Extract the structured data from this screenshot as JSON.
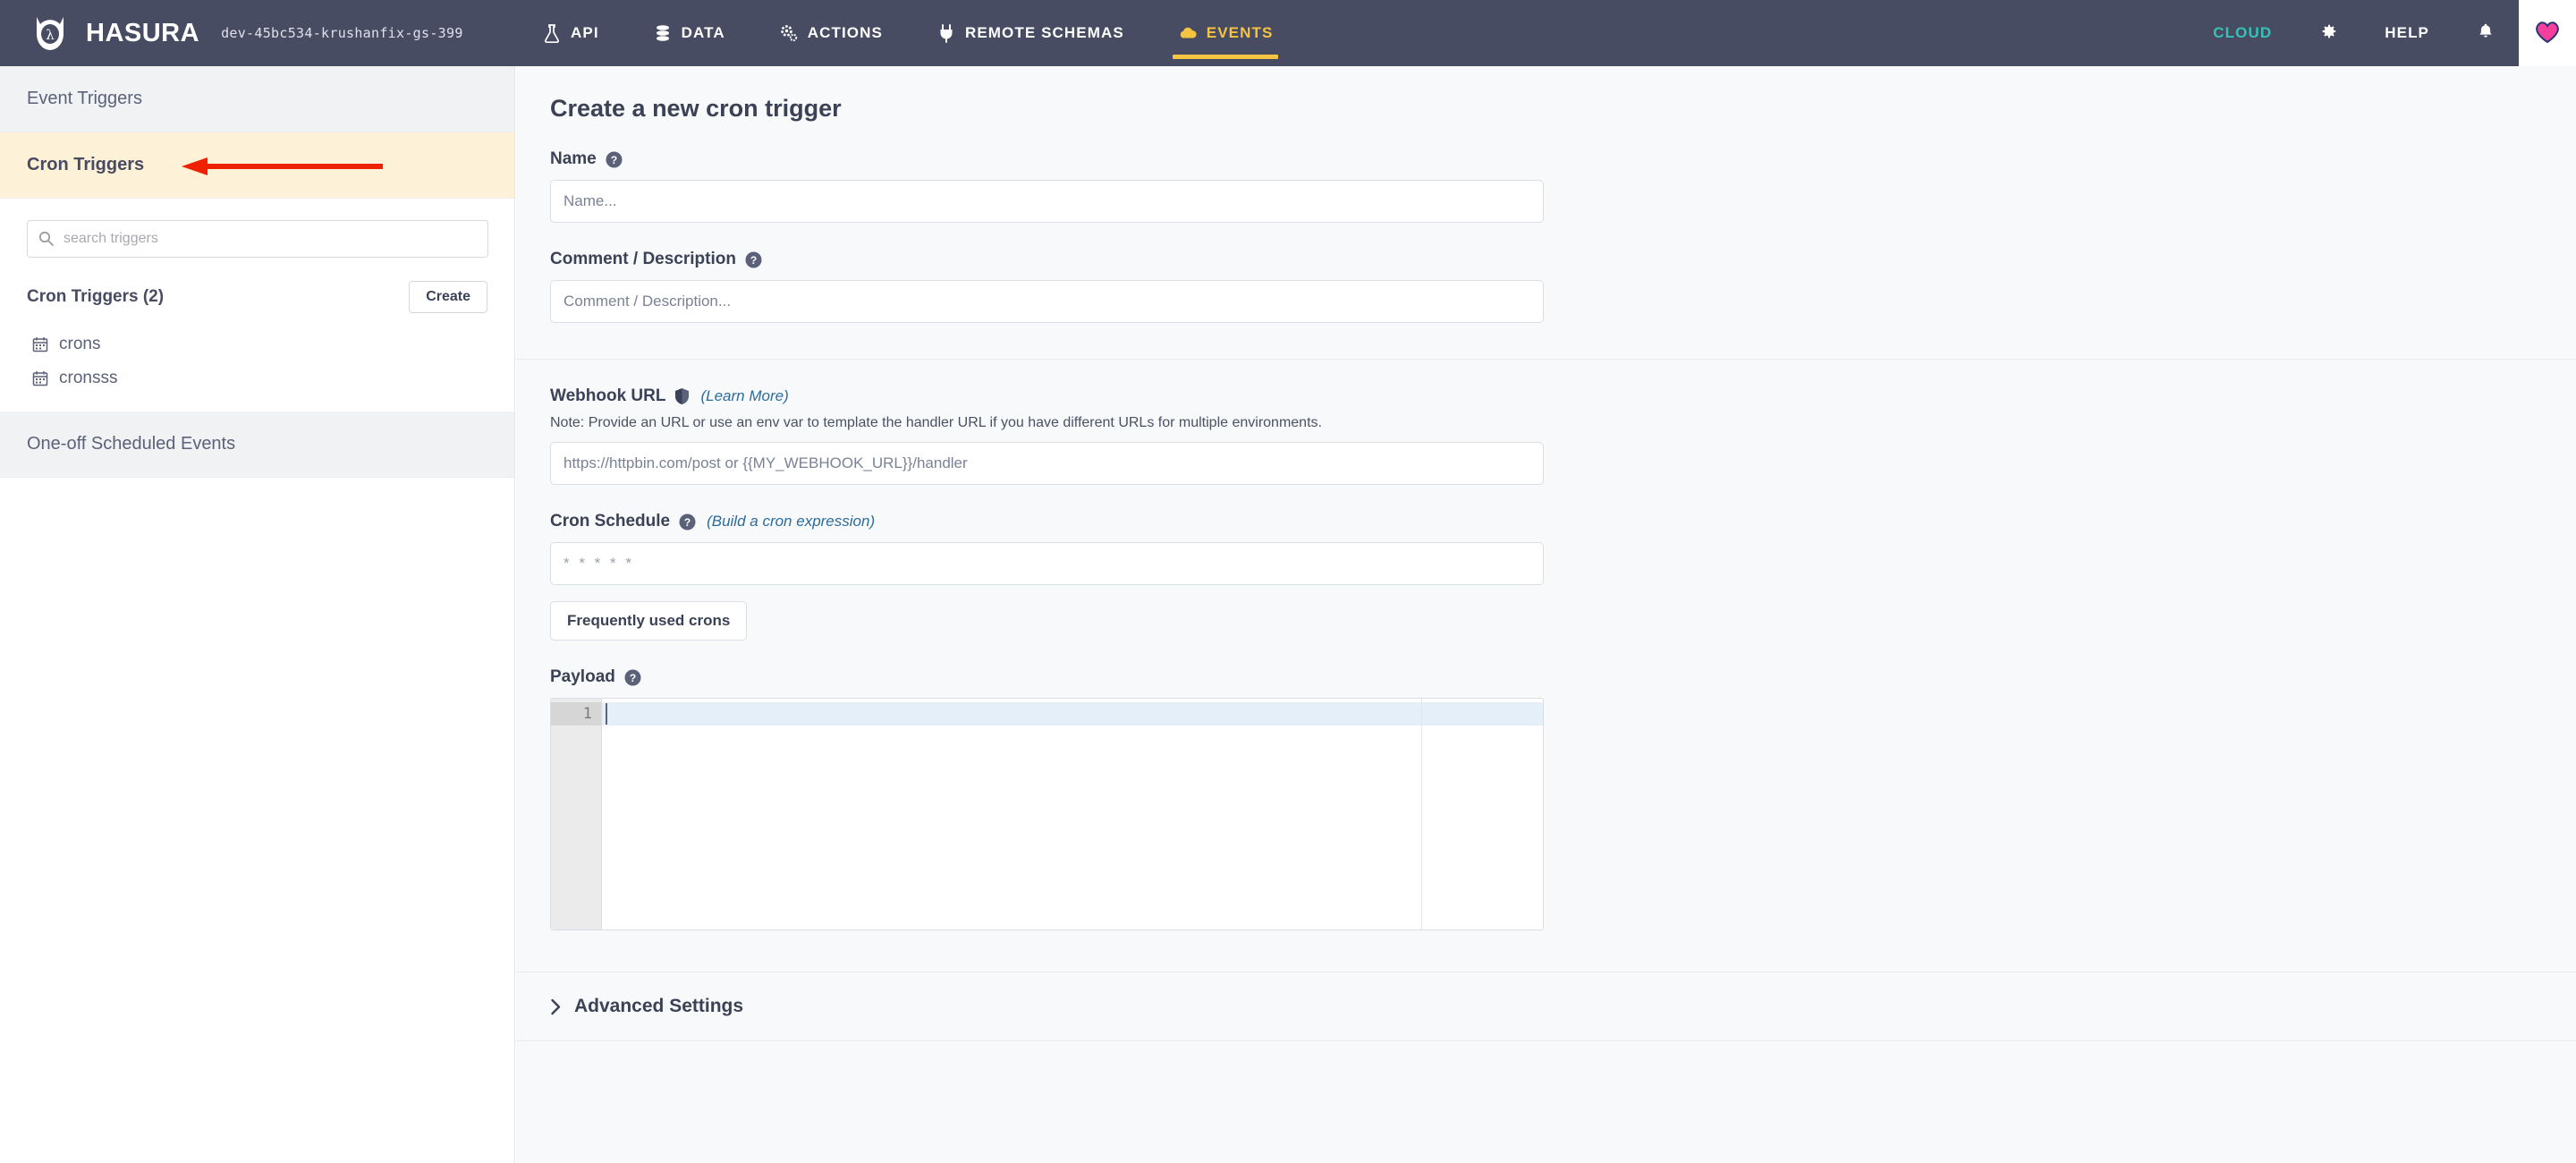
{
  "header": {
    "brand_name": "HASURA",
    "project_id": "dev-45bc534-krushanfix-gs-399",
    "tabs": [
      {
        "label": "API",
        "icon": "flask-icon",
        "active": false
      },
      {
        "label": "DATA",
        "icon": "database-icon",
        "active": false
      },
      {
        "label": "ACTIONS",
        "icon": "gears-icon",
        "active": false
      },
      {
        "label": "REMOTE SCHEMAS",
        "icon": "plug-icon",
        "active": false
      },
      {
        "label": "EVENTS",
        "icon": "cloud-icon",
        "active": true
      }
    ],
    "cloud_label": "CLOUD",
    "help_label": "HELP",
    "settings_icon": "gear-icon",
    "notifications_icon": "bell-icon",
    "avatar_icon": "heart-avatar-icon",
    "active_tab_color": "#f6c343",
    "cloud_color": "#36c2b7",
    "bar_color": "#484c63"
  },
  "sidebar": {
    "sections": [
      {
        "label": "Event Triggers",
        "highlighted": false
      },
      {
        "label": "Cron Triggers",
        "highlighted": true
      },
      {
        "label": "One-off Scheduled Events",
        "highlighted": false
      }
    ],
    "search": {
      "placeholder": "search triggers",
      "value": "",
      "icon": "search-icon"
    },
    "list_title": "Cron Triggers (2)",
    "create_label": "Create",
    "triggers": [
      {
        "name": "crons",
        "icon": "calendar-icon"
      },
      {
        "name": "cronsss",
        "icon": "calendar-icon"
      }
    ],
    "highlight_color": "#fdf2d7"
  },
  "annotation": {
    "type": "arrow",
    "color": "#ee2200",
    "direction": "left",
    "points_to": "Cron Triggers"
  },
  "main": {
    "title": "Create a new cron trigger",
    "fields": {
      "name": {
        "label": "Name",
        "help_icon": "question-circle-icon",
        "placeholder": "Name...",
        "value": ""
      },
      "comment": {
        "label": "Comment / Description",
        "help_icon": "question-circle-icon",
        "placeholder": "Comment / Description...",
        "value": ""
      },
      "webhook": {
        "label": "Webhook URL",
        "shield_icon": "shield-icon",
        "learn_more": "(Learn More)",
        "note": "Note: Provide an URL or use an env var to template the handler URL if you have different URLs for multiple environments.",
        "placeholder": "https://httpbin.com/post or {{MY_WEBHOOK_URL}}/handler",
        "value": ""
      },
      "schedule": {
        "label": "Cron Schedule",
        "help_icon": "question-circle-icon",
        "builder_link": "(Build a cron expression)",
        "placeholder": "* * * * *",
        "value": "",
        "frequent_button": "Frequently used crons"
      },
      "payload": {
        "label": "Payload",
        "help_icon": "question-circle-icon",
        "line_numbers": [
          "1"
        ],
        "content": ""
      }
    },
    "advanced": {
      "label": "Advanced Settings",
      "icon": "chevron-right-icon",
      "expanded": false
    }
  }
}
